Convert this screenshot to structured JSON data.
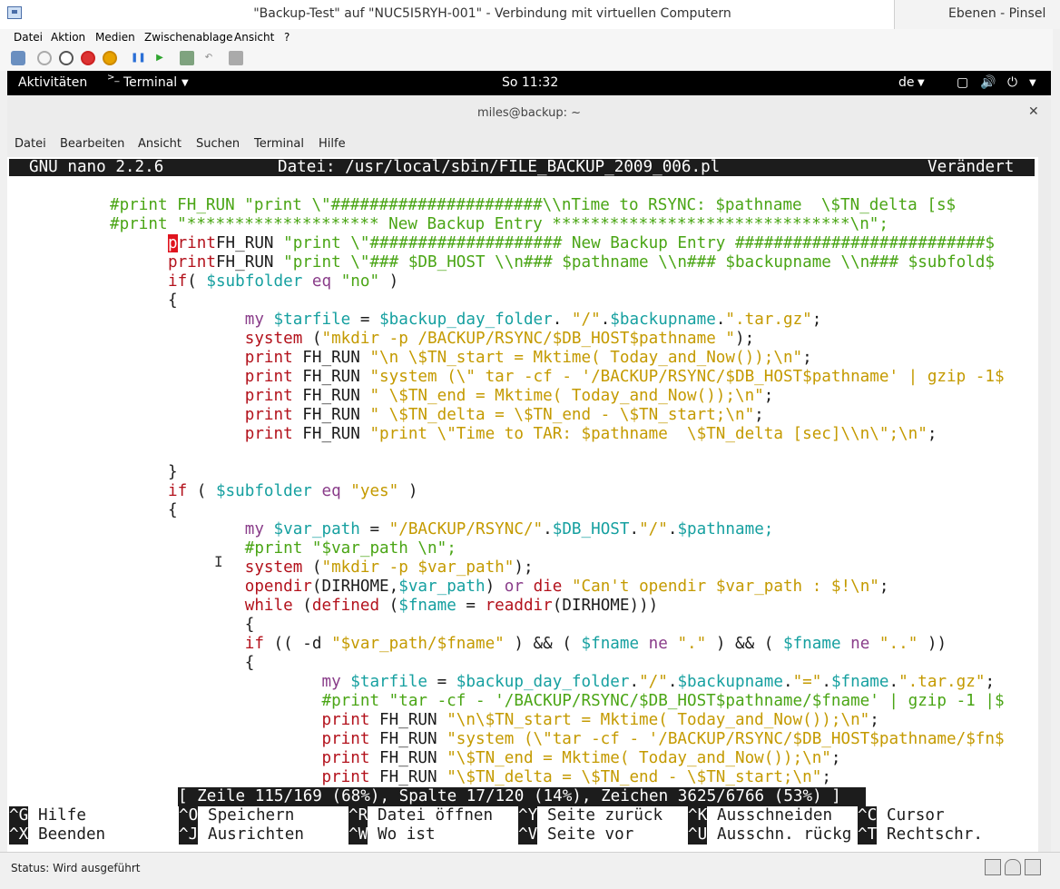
{
  "vm": {
    "title": "\"Backup-Test\" auf \"NUC5I5RYH-001\" - Verbindung mit virtuellen Computern",
    "right_app_title": "Ebenen - Pinsel",
    "menu": [
      "Datei",
      "Aktion",
      "Medien",
      "Zwischenablage",
      "Ansicht",
      "?"
    ],
    "status": "Status: Wird ausgeführt"
  },
  "gnome": {
    "activities": "Aktivitäten",
    "app": "Terminal",
    "clock": "So 11:32",
    "lang": "de"
  },
  "terminal": {
    "title": "miles@backup: ~",
    "menu": [
      "Datei",
      "Bearbeiten",
      "Ansicht",
      "Suchen",
      "Terminal",
      "Hilfe"
    ]
  },
  "nano": {
    "version": "GNU nano 2.2.6",
    "file": "Datei: /usr/local/sbin/FILE_BACKUP_2009_006.pl",
    "modified": "Verändert",
    "status": "[ Zeile 115/169 (68%), Spalte 17/120 (14%), Zeichen 3625/6766 (53%) ]",
    "shortcuts_row1": [
      {
        "key": "^G",
        "label": "Hilfe"
      },
      {
        "key": "^O",
        "label": "Speichern"
      },
      {
        "key": "^R",
        "label": "Datei öffnen"
      },
      {
        "key": "^Y",
        "label": "Seite zurück"
      },
      {
        "key": "^K",
        "label": "Ausschneiden"
      },
      {
        "key": "^C",
        "label": "Cursor"
      }
    ],
    "shortcuts_row2": [
      {
        "key": "^X",
        "label": "Beenden"
      },
      {
        "key": "^J",
        "label": "Ausrichten"
      },
      {
        "key": "^W",
        "label": "Wo ist"
      },
      {
        "key": "^V",
        "label": "Seite vor"
      },
      {
        "key": "^U",
        "label": "Ausschn. rückg"
      },
      {
        "key": "^T",
        "label": "Rechtschr."
      }
    ],
    "lines": [
      [
        [
          "cmt",
          "        #print FH_RUN \"print \\\"######################\\\\nTime to RSYNC: $pathname  \\$TN_delta [s$"
        ]
      ],
      [
        [
          "cmt",
          "        #print \"******************** New Backup Entry *******************************\\n\";"
        ]
      ],
      [
        [
          "cursor",
          "p"
        ],
        [
          "kw",
          "rint"
        ],
        [
          "",
          "FH_RUN "
        ],
        [
          "cmt",
          "\"print \\\"#################### New Backup Entry ##########################$"
        ]
      ],
      [
        [
          "kw",
          "print"
        ],
        [
          "",
          "FH_RUN "
        ],
        [
          "cmt",
          "\"print \\\"### $DB_HOST \\\\n### $pathname \\\\n### $backupname \\\\n### $subfold$"
        ]
      ],
      [
        [
          "kw",
          "if"
        ],
        [
          "",
          "( "
        ],
        [
          "var",
          "$subfolder"
        ],
        [
          "",
          " "
        ],
        [
          "my",
          "eq"
        ],
        [
          "",
          " "
        ],
        [
          "cmt",
          "\"no\""
        ],
        [
          "",
          " )"
        ]
      ],
      [
        [
          "",
          "{"
        ]
      ],
      [
        [
          "",
          "        "
        ],
        [
          "my",
          "my"
        ],
        [
          "",
          " "
        ],
        [
          "var",
          "$tarfile"
        ],
        [
          "",
          " = "
        ],
        [
          "var",
          "$backup_day_folder"
        ],
        [
          "",
          ". "
        ],
        [
          "str",
          "\"/\""
        ],
        [
          "",
          "."
        ],
        [
          "var",
          "$backupname"
        ],
        [
          "",
          "."
        ],
        [
          "str",
          "\".tar.gz\""
        ],
        [
          "",
          ";"
        ]
      ],
      [
        [
          "",
          "        "
        ],
        [
          "kw",
          "system"
        ],
        [
          "",
          " ("
        ],
        [
          "str",
          "\"mkdir -p /BACKUP/RSYNC/$DB_HOST$pathname \""
        ],
        [
          "",
          ");"
        ]
      ],
      [
        [
          "",
          "        "
        ],
        [
          "kw",
          "print"
        ],
        [
          "",
          " FH_RUN "
        ],
        [
          "str",
          "\"\\n \\$TN_start = Mktime( Today_and_Now());\\n\""
        ],
        [
          "",
          ";"
        ]
      ],
      [
        [
          "",
          "        "
        ],
        [
          "kw",
          "print"
        ],
        [
          "",
          " FH_RUN "
        ],
        [
          "str",
          "\"system (\\\" tar -cf - '/BACKUP/RSYNC/$DB_HOST$pathname' | gzip -1$"
        ]
      ],
      [
        [
          "",
          "        "
        ],
        [
          "kw",
          "print"
        ],
        [
          "",
          " FH_RUN "
        ],
        [
          "str",
          "\" \\$TN_end = Mktime( Today_and_Now());\\n\""
        ],
        [
          "",
          ";"
        ]
      ],
      [
        [
          "",
          "        "
        ],
        [
          "kw",
          "print"
        ],
        [
          "",
          " FH_RUN "
        ],
        [
          "str",
          "\" \\$TN_delta = \\$TN_end - \\$TN_start;\\n\""
        ],
        [
          "",
          ";"
        ]
      ],
      [
        [
          "",
          "        "
        ],
        [
          "kw",
          "print"
        ],
        [
          "",
          " FH_RUN "
        ],
        [
          "str",
          "\"print \\\"Time to TAR: $pathname  \\$TN_delta [sec]\\\\n\\\";\\n\""
        ],
        [
          "",
          ";"
        ]
      ],
      [
        [
          "",
          ""
        ]
      ],
      [
        [
          "",
          "}"
        ]
      ],
      [
        [
          "kw",
          "if"
        ],
        [
          "",
          " ( "
        ],
        [
          "var",
          "$subfolder"
        ],
        [
          "",
          " "
        ],
        [
          "my",
          "eq"
        ],
        [
          "",
          " "
        ],
        [
          "str",
          "\"yes\""
        ],
        [
          "",
          " )"
        ]
      ],
      [
        [
          "",
          "{"
        ]
      ],
      [
        [
          "",
          "        "
        ],
        [
          "my",
          "my"
        ],
        [
          "",
          " "
        ],
        [
          "var",
          "$var_path"
        ],
        [
          "",
          " = "
        ],
        [
          "str",
          "\"/BACKUP/RSYNC/\""
        ],
        [
          "",
          "."
        ],
        [
          "var",
          "$DB_HOST"
        ],
        [
          "",
          "."
        ],
        [
          "str",
          "\"/\""
        ],
        [
          "",
          "."
        ],
        [
          "var",
          "$pathname;"
        ]
      ],
      [
        [
          "",
          "        "
        ],
        [
          "cmt",
          "#print \"$var_path \\n\";"
        ]
      ],
      [
        [
          "",
          "        "
        ],
        [
          "kw",
          "system"
        ],
        [
          "",
          " ("
        ],
        [
          "str",
          "\"mkdir -p $var_path\""
        ],
        [
          "",
          ");"
        ]
      ],
      [
        [
          "",
          "        "
        ],
        [
          "kw",
          "opendir"
        ],
        [
          "",
          "(DIRHOME,"
        ],
        [
          "var",
          "$var_path"
        ],
        [
          "",
          ") "
        ],
        [
          "my",
          "or"
        ],
        [
          "",
          " "
        ],
        [
          "kw",
          "die"
        ],
        [
          "",
          " "
        ],
        [
          "str",
          "\"Can't opendir $var_path : $!\\n\""
        ],
        [
          "",
          ";"
        ]
      ],
      [
        [
          "",
          "        "
        ],
        [
          "kw",
          "while"
        ],
        [
          "",
          " ("
        ],
        [
          "kw",
          "defined"
        ],
        [
          "",
          " ("
        ],
        [
          "var",
          "$fname"
        ],
        [
          "",
          " = "
        ],
        [
          "kw",
          "readdir"
        ],
        [
          "",
          "(DIRHOME)))"
        ]
      ],
      [
        [
          "",
          "        {"
        ]
      ],
      [
        [
          "",
          "        "
        ],
        [
          "kw",
          "if"
        ],
        [
          "",
          " (( -d "
        ],
        [
          "str",
          "\"$var_path/$fname\""
        ],
        [
          "",
          " ) && ( "
        ],
        [
          "var",
          "$fname"
        ],
        [
          "",
          " "
        ],
        [
          "my",
          "ne"
        ],
        [
          "",
          " "
        ],
        [
          "str",
          "\".\""
        ],
        [
          "",
          " ) && ( "
        ],
        [
          "var",
          "$fname"
        ],
        [
          "",
          " "
        ],
        [
          "my",
          "ne"
        ],
        [
          "",
          " "
        ],
        [
          "str",
          "\"..\""
        ],
        [
          "",
          " ))"
        ]
      ],
      [
        [
          "",
          "        {"
        ]
      ],
      [
        [
          "",
          "                "
        ],
        [
          "my",
          "my"
        ],
        [
          "",
          " "
        ],
        [
          "var",
          "$tarfile"
        ],
        [
          "",
          " = "
        ],
        [
          "var",
          "$backup_day_folder"
        ],
        [
          "",
          "."
        ],
        [
          "str",
          "\"/\""
        ],
        [
          "",
          "."
        ],
        [
          "var",
          "$backupname"
        ],
        [
          "",
          "."
        ],
        [
          "str",
          "\"=\""
        ],
        [
          "",
          "."
        ],
        [
          "var",
          "$fname"
        ],
        [
          "",
          "."
        ],
        [
          "str",
          "\".tar.gz\""
        ],
        [
          "",
          ";"
        ]
      ],
      [
        [
          "",
          "                "
        ],
        [
          "cmt",
          "#print \"tar -cf - '/BACKUP/RSYNC/$DB_HOST$pathname/$fname' | gzip -1 |$"
        ]
      ],
      [
        [
          "",
          "                "
        ],
        [
          "kw",
          "print"
        ],
        [
          "",
          " FH_RUN "
        ],
        [
          "str",
          "\"\\n\\$TN_start = Mktime( Today_and_Now());\\n\""
        ],
        [
          "",
          ";"
        ]
      ],
      [
        [
          "",
          "                "
        ],
        [
          "kw",
          "print"
        ],
        [
          "",
          " FH_RUN "
        ],
        [
          "str",
          "\"system (\\\"tar -cf - '/BACKUP/RSYNC/$DB_HOST$pathname/$fn$"
        ]
      ],
      [
        [
          "",
          "                "
        ],
        [
          "kw",
          "print"
        ],
        [
          "",
          " FH_RUN "
        ],
        [
          "str",
          "\"\\$TN_end = Mktime( Today_and_Now());\\n\""
        ],
        [
          "",
          ";"
        ]
      ],
      [
        [
          "",
          "                "
        ],
        [
          "kw",
          "print"
        ],
        [
          "",
          " FH_RUN "
        ],
        [
          "str",
          "\"\\$TN_delta = \\$TN_end - \\$TN_start;\\n\""
        ],
        [
          "",
          ";"
        ]
      ]
    ]
  }
}
